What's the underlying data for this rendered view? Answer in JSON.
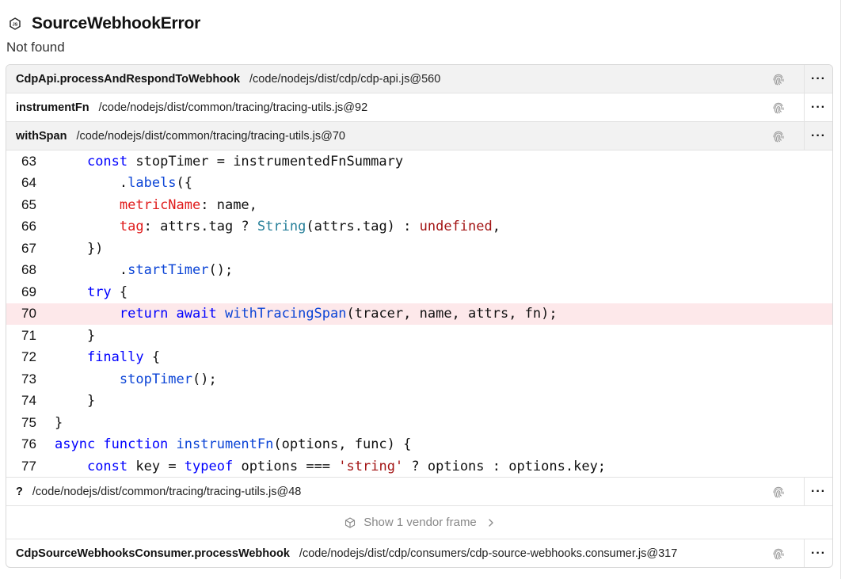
{
  "header": {
    "title": "SourceWebhookError",
    "subtitle": "Not found",
    "icon": "nodejs-icon"
  },
  "frames": [
    {
      "function": "CdpApi.processAndRespondToWebhook",
      "path": "/code/nodejs/dist/cdp/cdp-api.js@560"
    },
    {
      "function": "instrumentFn",
      "path": "/code/nodejs/dist/common/tracing/tracing-utils.js@92"
    },
    {
      "function": "withSpan",
      "path": "/code/nodejs/dist/common/tracing/tracing-utils.js@70"
    },
    {
      "function": "?",
      "path": "/code/nodejs/dist/common/tracing/tracing-utils.js@48"
    },
    {
      "function": "CdpSourceWebhooksConsumer.processWebhook",
      "path": "/code/nodejs/dist/cdp/consumers/cdp-source-webhooks.consumer.js@317"
    }
  ],
  "more_label": "···",
  "vendor": {
    "label": "Show 1 vendor frame"
  },
  "code": {
    "highlight_line": "70",
    "lines": [
      {
        "n": "63",
        "t0": "    ",
        "t1": "const",
        "t2": " stopTimer = instrumentedFnSummary"
      },
      {
        "n": "64",
        "t0": "        .",
        "t1": "labels",
        "t2": "({"
      },
      {
        "n": "65",
        "t0": "        ",
        "t1": "metricName",
        "t2": ": name,"
      },
      {
        "n": "66",
        "t0": "        ",
        "t1": "tag",
        "t2": ": attrs.tag ? ",
        "t3": "String",
        "t4": "(attrs.tag) : ",
        "t5": "undefined",
        "t6": ","
      },
      {
        "n": "67",
        "t0": "    })"
      },
      {
        "n": "68",
        "t0": "        .",
        "t1": "startTimer",
        "t2": "();"
      },
      {
        "n": "69",
        "t0": "    ",
        "t1": "try",
        "t2": " {"
      },
      {
        "n": "70",
        "t0": "        ",
        "t1": "return await",
        "t2": " ",
        "t3": "withTracingSpan",
        "t4": "(tracer, name, attrs, fn);"
      },
      {
        "n": "71",
        "t0": "    }"
      },
      {
        "n": "72",
        "t0": "    ",
        "t1": "finally",
        "t2": " {"
      },
      {
        "n": "73",
        "t0": "        ",
        "t1": "stopTimer",
        "t2": "();"
      },
      {
        "n": "74",
        "t0": "    }"
      },
      {
        "n": "75",
        "t0": "}"
      },
      {
        "n": "76",
        "t1": "async function",
        "t2": " ",
        "t3": "instrumentFn",
        "t4": "(options, func) {"
      },
      {
        "n": "77",
        "t0": "    ",
        "t1": "const",
        "t2": " key = ",
        "t3": "typeof",
        "t4": " options === ",
        "t5": "'string'",
        "t6": " ? options : options.key;"
      }
    ]
  },
  "colors": {
    "keyword": "#0000ff",
    "function": "#0b44d6",
    "property": "#e01b1b",
    "type": "#267f99",
    "literal": "#a31515",
    "highlight_bg": "#fde8ea",
    "frame_header_bg": "#f2f2f2"
  }
}
